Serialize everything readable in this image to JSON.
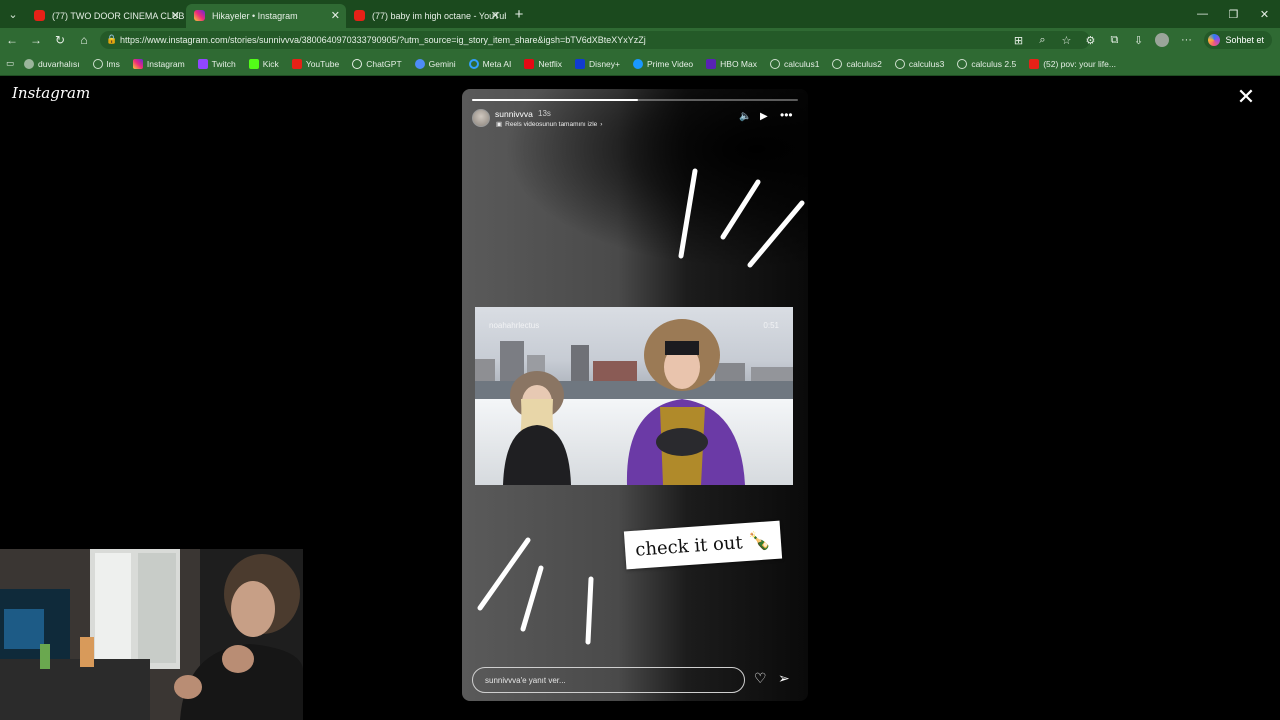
{
  "browser": {
    "tabs": [
      {
        "title": "(77) TWO DOOR CINEMA CLUB | S",
        "icon": "youtube-icon",
        "color": "#ff0000",
        "active": false
      },
      {
        "title": "Hikayeler • Instagram",
        "icon": "instagram-icon",
        "color": "#d62976",
        "active": true
      },
      {
        "title": "(77) baby im high octane - YouTub",
        "icon": "youtube-icon",
        "color": "#ff0000",
        "active": false
      }
    ],
    "url": "https://www.instagram.com/stories/sunnivvva/3800640970333790905/?utm_source=ig_story_item_share&igsh=bTV6dXBteXYxYzZj",
    "copilot_label": "Sohbet et",
    "bookmarks": [
      {
        "label": "duvarhalısı",
        "icon": "globe-icon"
      },
      {
        "label": "lms",
        "icon": "globe-icon"
      },
      {
        "label": "Instagram",
        "icon": "instagram-icon"
      },
      {
        "label": "Twitch",
        "icon": "twitch-icon"
      },
      {
        "label": "Kick",
        "icon": "kick-icon"
      },
      {
        "label": "YouTube",
        "icon": "youtube-icon"
      },
      {
        "label": "ChatGPT",
        "icon": "chatgpt-icon"
      },
      {
        "label": "Gemini",
        "icon": "gemini-icon"
      },
      {
        "label": "Meta AI",
        "icon": "meta-ai-icon"
      },
      {
        "label": "Netflix",
        "icon": "netflix-icon"
      },
      {
        "label": "Disney+",
        "icon": "disney-icon"
      },
      {
        "label": "Prime Video",
        "icon": "prime-video-icon"
      },
      {
        "label": "HBO Max",
        "icon": "hbo-icon"
      },
      {
        "label": "calculus1",
        "icon": "globe-icon"
      },
      {
        "label": "calculus2",
        "icon": "globe-icon"
      },
      {
        "label": "calculus3",
        "icon": "globe-icon"
      },
      {
        "label": "calculus 2.5",
        "icon": "globe-icon"
      },
      {
        "label": "(52) pov: your life...",
        "icon": "youtube-icon"
      }
    ]
  },
  "page": {
    "logo": "Instagram",
    "story": {
      "username": "sunnivvva",
      "time": "13s",
      "reels_link": "Reels videosunun tamamını izle",
      "progress": 0.51,
      "clip_watermark_left": "noahahrlectus",
      "clip_watermark_right": "0:51",
      "sticker_text": "check it out 🍾",
      "reply_placeholder": "sunnivvva'e yanıt ver..."
    }
  }
}
